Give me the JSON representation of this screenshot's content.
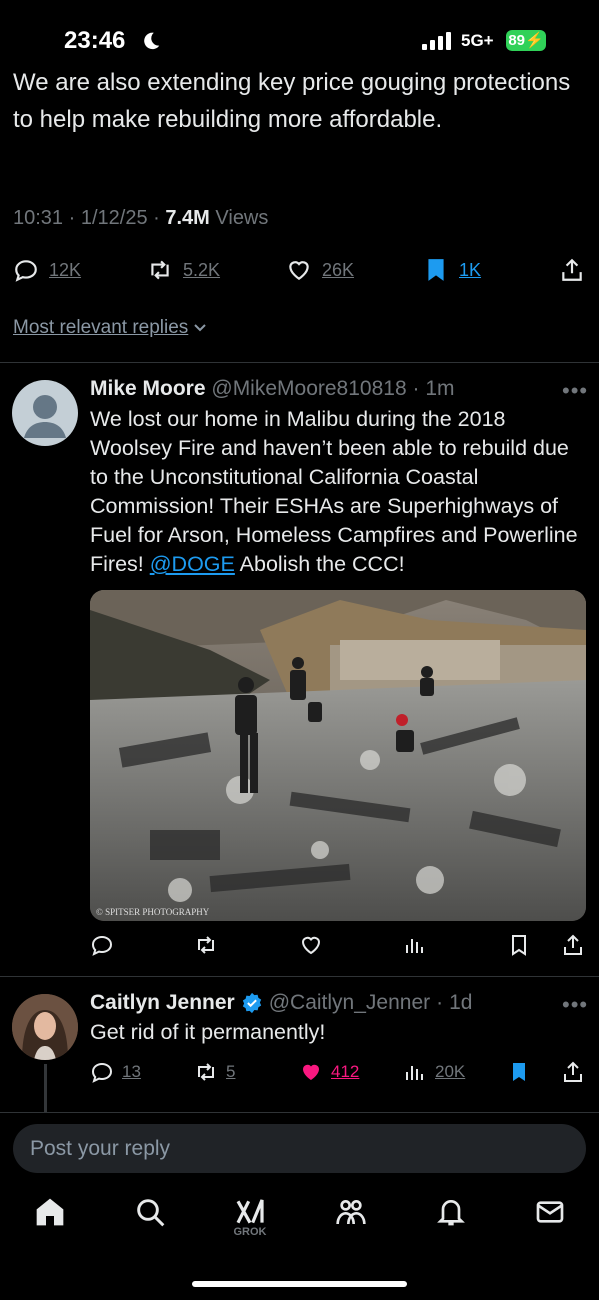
{
  "status_bar": {
    "time": "23:46",
    "network": "5G+",
    "battery": "89"
  },
  "main_tweet": {
    "text": "We are also extending key price gouging protections to help make rebuilding more affordable.",
    "time": "10:31",
    "date": "1/12/25",
    "views_count": "7.4M",
    "views_label": "Views",
    "replies": "12K",
    "reposts": "5.2K",
    "likes": "26K",
    "bookmarks": "1K"
  },
  "sort": {
    "label": "Most relevant replies"
  },
  "replies": [
    {
      "name": "Mike Moore",
      "handle": "@MikeMoore810818",
      "time": "1m",
      "text_before": "We lost our home in Malibu during the 2018 Woolsey Fire and haven’t been able to rebuild due to the Unconstitutional California Coastal Commission! Their ESHAs are Superhighways of Fuel for Arson, Homeless Campfires and Powerline Fires!",
      "mention": "@DOGE",
      "text_after": "Abolish the CCC!",
      "photo_credit": "© SPITSER PHOTOGRAPHY"
    },
    {
      "name": "Caitlyn Jenner",
      "handle": "@Caitlyn_Jenner",
      "time": "1d",
      "text": "Get rid of it permanently!",
      "replies": "13",
      "reposts": "5",
      "likes": "412",
      "views": "20K"
    }
  ],
  "composer": {
    "placeholder": "Post your reply"
  },
  "tab_bar": {
    "grok_label": "GROK"
  },
  "colors": {
    "accent": "#1d9bf0",
    "like": "#f91880",
    "background": "#000000",
    "muted": "#71767b"
  }
}
